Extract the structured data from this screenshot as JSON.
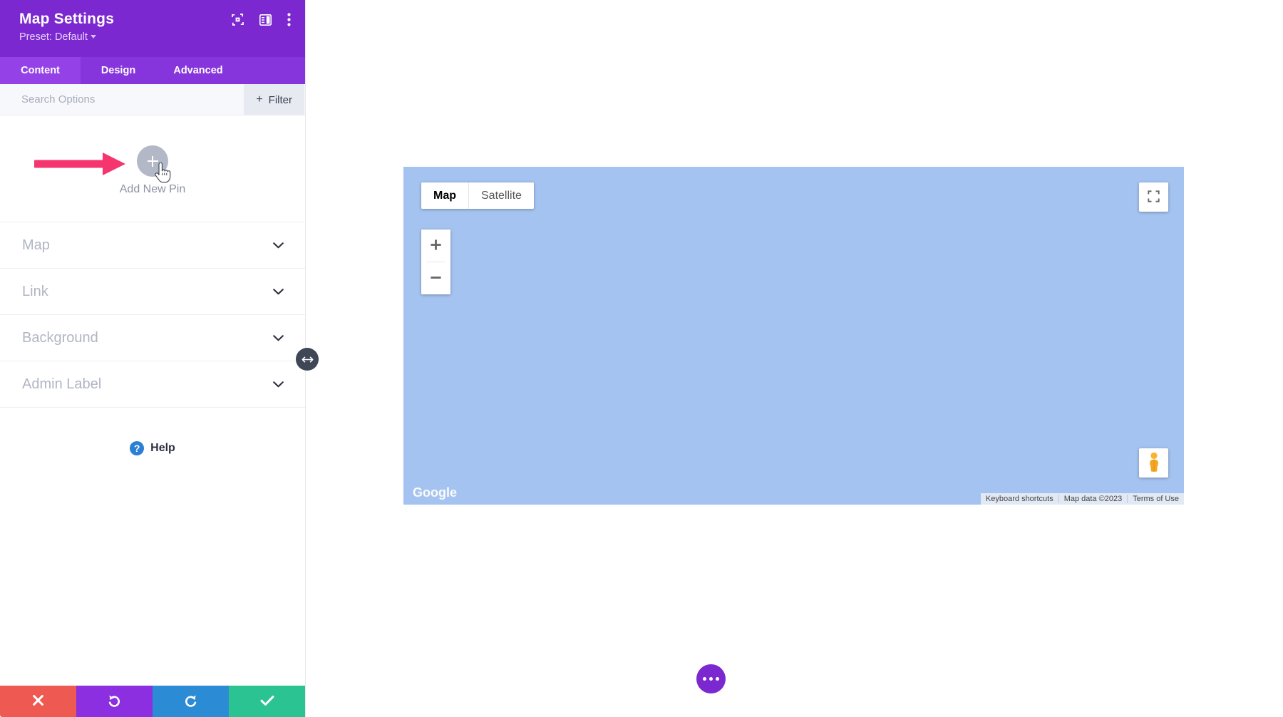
{
  "panel": {
    "title": "Map Settings",
    "preset_label": "Preset: Default",
    "header_icons": [
      {
        "name": "focus-target-icon"
      },
      {
        "name": "layout-panel-icon"
      },
      {
        "name": "more-vertical-icon"
      }
    ],
    "tabs": [
      {
        "label": "Content",
        "active": true
      },
      {
        "label": "Design",
        "active": false
      },
      {
        "label": "Advanced",
        "active": false
      }
    ],
    "search": {
      "placeholder": "Search Options",
      "value": "",
      "filter_label": "Filter",
      "filter_plus": "+"
    },
    "add_pin": {
      "label": "Add New Pin",
      "plus": "+"
    },
    "sections": [
      {
        "label": "Map"
      },
      {
        "label": "Link"
      },
      {
        "label": "Background"
      },
      {
        "label": "Admin Label"
      }
    ],
    "help": {
      "label": "Help",
      "badge": "?"
    },
    "actions": [
      {
        "name": "cancel-button",
        "icon": "close-icon",
        "color": "#ee5a52"
      },
      {
        "name": "undo-button",
        "icon": "undo-icon",
        "color": "#8b2fe0"
      },
      {
        "name": "redo-button",
        "icon": "redo-icon",
        "color": "#2b8bd4"
      },
      {
        "name": "save-button",
        "icon": "check-icon",
        "color": "#2cc392"
      }
    ],
    "resize_handle": {
      "icon": "resize-horizontal-icon"
    }
  },
  "map": {
    "type_buttons": [
      {
        "label": "Map",
        "active": true
      },
      {
        "label": "Satellite",
        "active": false
      }
    ],
    "zoom_in_label": "+",
    "zoom_out_label": "−",
    "logo_text": "Google",
    "attribution": [
      {
        "text": "Keyboard shortcuts",
        "link": true
      },
      {
        "text": "Map data ©2023",
        "link": false
      },
      {
        "text": "Terms of Use",
        "link": true
      }
    ],
    "background_color": "#a5c3f0"
  },
  "fab": {
    "name": "more-options-fab"
  },
  "annotation": {
    "arrow_color": "#f5356e"
  }
}
